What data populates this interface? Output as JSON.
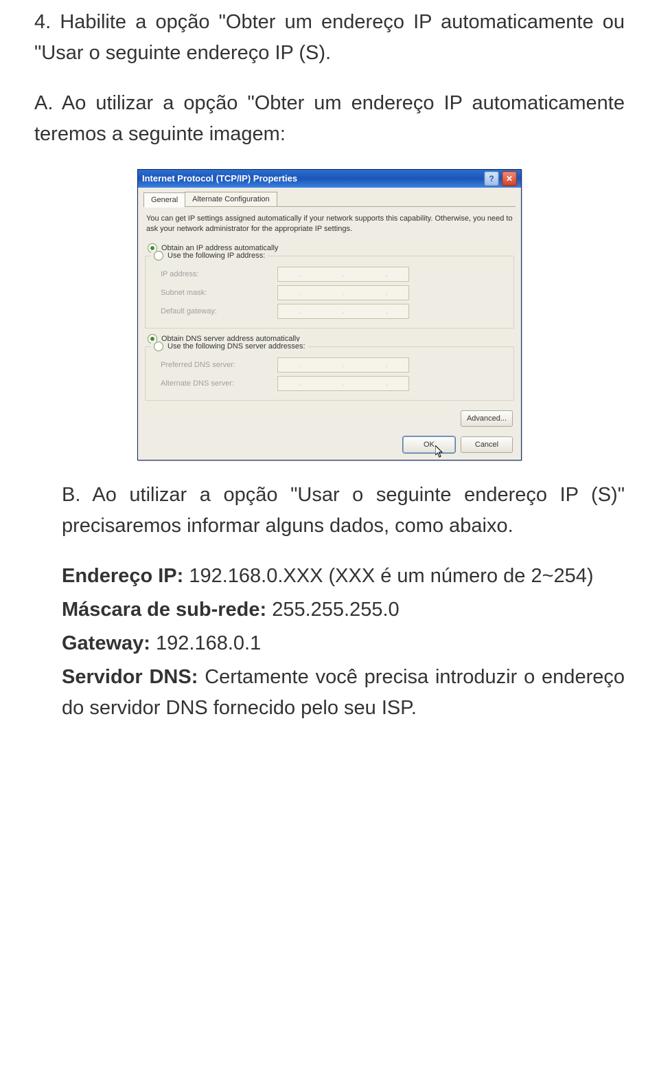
{
  "para1": "4. Habilite a opção \"Obter um endereço IP automaticamente ou \"Usar o seguinte endereço IP (S).",
  "para2": "A. Ao utilizar a opção \"Obter um endereço IP automaticamente teremos a seguinte imagem:",
  "dialog": {
    "title": "Internet Protocol (TCP/IP) Properties",
    "help_icon": "?",
    "close_icon": "✕",
    "tab_general": "General",
    "tab_alt": "Alternate Configuration",
    "description": "You can get IP settings assigned automatically if your network supports this capability. Otherwise, you need to ask your network administrator for the appropriate IP settings.",
    "radio_auto_ip": "Obtain an IP address automatically",
    "radio_use_ip": "Use the following IP address:",
    "label_ip": "IP address:",
    "label_subnet": "Subnet mask:",
    "label_gateway": "Default gateway:",
    "radio_auto_dns": "Obtain DNS server address automatically",
    "radio_use_dns": "Use the following DNS server addresses:",
    "label_pref_dns": "Preferred DNS server:",
    "label_alt_dns": "Alternate DNS server:",
    "btn_advanced": "Advanced...",
    "btn_ok": "OK",
    "btn_cancel": "Cancel"
  },
  "para3": "B. Ao utilizar a opção \"Usar o seguinte endereço IP (S)\" precisaremos informar alguns dados, como abaixo.",
  "spec": {
    "ip_label": "Endereço IP: ",
    "ip_value": "192.168.0.XXX (XXX é um número de 2~254)",
    "mask_label": "Máscara de sub-rede: ",
    "mask_value": "255.255.255.0",
    "gw_label": "Gateway: ",
    "gw_value": "192.168.0.1",
    "dns_label": "Servidor DNS: ",
    "dns_value": "Certamente você precisa introduzir o endereço do servidor DNS fornecido pelo seu ISP."
  }
}
